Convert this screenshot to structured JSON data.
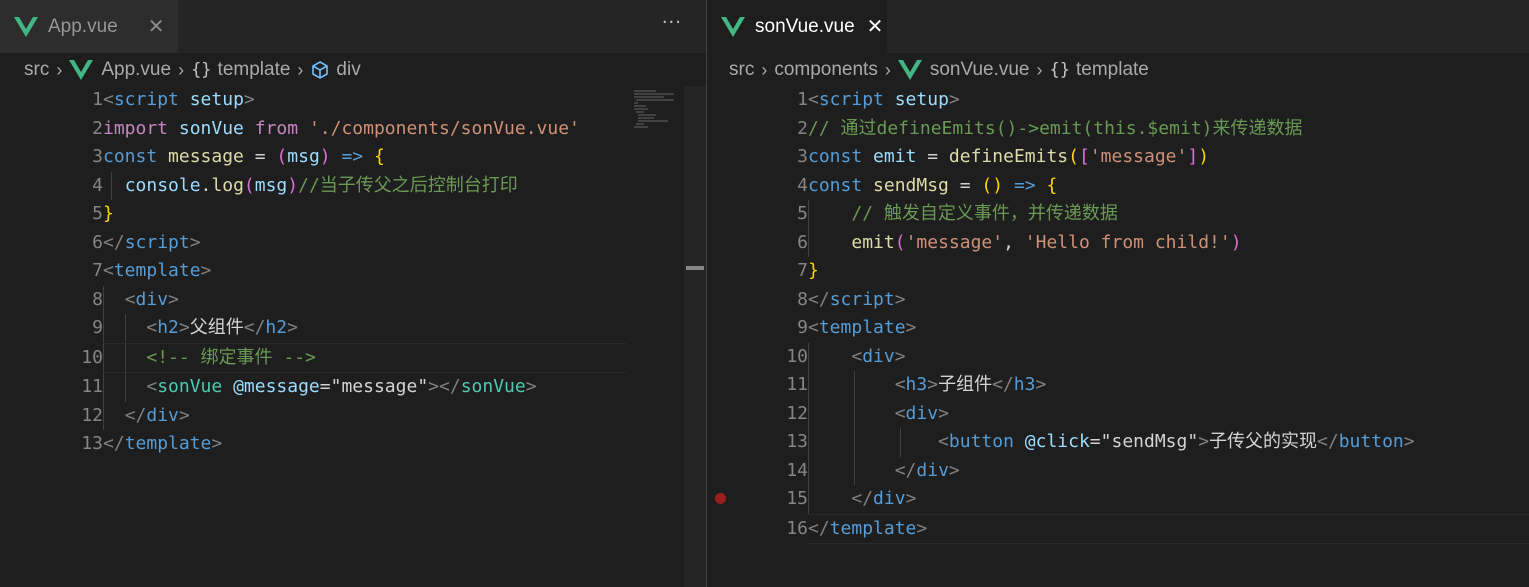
{
  "left": {
    "tab": {
      "label": "App.vue",
      "close": "✕"
    },
    "more": "···",
    "breadcrumb": [
      "src",
      "App.vue",
      "template",
      "div"
    ],
    "lines": [
      "1",
      "2",
      "3",
      "4",
      "5",
      "6",
      "7",
      "8",
      "9",
      "10",
      "11",
      "12",
      "13"
    ]
  },
  "right": {
    "tab": {
      "label": "sonVue.vue",
      "close": "✕"
    },
    "breadcrumb": [
      "src",
      "components",
      "sonVue.vue",
      "template"
    ],
    "lines": [
      "1",
      "2",
      "3",
      "4",
      "5",
      "6",
      "7",
      "8",
      "9",
      "10",
      "11",
      "12",
      "13",
      "14",
      "15",
      "16"
    ]
  },
  "code_left": {
    "l1": {
      "open": "<",
      "name": "script",
      "attr": "setup",
      "close": ">"
    },
    "l2": {
      "import": "import",
      "ident": "sonVue",
      "from": "from",
      "path": "'./components/sonVue.vue'"
    },
    "l3": {
      "const": "const",
      "name": "message",
      "eq": "=",
      "lp": "(",
      "arg": "msg",
      "rp": ")",
      "arrow": "=>",
      "lb": "{"
    },
    "l4": {
      "obj": "console",
      "dot": ".",
      "fn": "log",
      "lp": "(",
      "arg": "msg",
      "rp": ")",
      "comment": "//当子传父之后控制台打印"
    },
    "l5": {
      "rb": "}"
    },
    "l6": {
      "open": "</",
      "name": "script",
      "close": ">"
    },
    "l7": {
      "open": "<",
      "name": "template",
      "close": ">"
    },
    "l8": {
      "open": "<",
      "name": "div",
      "close": ">"
    },
    "l9": {
      "open": "<",
      "name": "h2",
      "close": ">",
      "text": "父组件",
      "open2": "</",
      "name2": "h2",
      "close2": ">"
    },
    "l10": {
      "comment": "<!-- 绑定事件 -->"
    },
    "l11": {
      "open": "<",
      "name": "sonVue",
      "attr": "@message",
      "eq": "=",
      "val": "\"message\"",
      "close": ">",
      "open2": "</",
      "name2": "sonVue",
      "close2": ">"
    },
    "l12": {
      "open": "</",
      "name": "div",
      "close": ">"
    },
    "l13": {
      "open": "</",
      "name": "template",
      "close": ">"
    }
  },
  "code_right": {
    "l1": {
      "open": "<",
      "name": "script",
      "attr": "setup",
      "close": ">"
    },
    "l2": {
      "comment": "// 通过defineEmits()->emit(this.$emit)来传递数据"
    },
    "l3": {
      "const": "const",
      "name": "emit",
      "eq": "=",
      "fn": "defineEmits",
      "lp": "(",
      "lb": "[",
      "str": "'message'",
      "rb": "]",
      "rp": ")"
    },
    "l4": {
      "const": "const",
      "name": "sendMsg",
      "eq": "=",
      "parens": "()",
      "arrow": "=>",
      "lb": "{"
    },
    "l5": {
      "comment": "// 触发自定义事件，并传递数据"
    },
    "l6": {
      "fn": "emit",
      "lp": "(",
      "s1": "'message'",
      "comma": ",",
      "s2": "'Hello from child!'",
      "rp": ")"
    },
    "l7": {
      "rb": "}"
    },
    "l8": {
      "open": "</",
      "name": "script",
      "close": ">"
    },
    "l9": {
      "open": "<",
      "name": "template",
      "close": ">"
    },
    "l10": {
      "open": "<",
      "name": "div",
      "close": ">"
    },
    "l11": {
      "open": "<",
      "name": "h3",
      "close": ">",
      "text": "子组件",
      "open2": "</",
      "name2": "h3",
      "close2": ">"
    },
    "l12": {
      "open": "<",
      "name": "div",
      "close": ">"
    },
    "l13": {
      "open": "<",
      "name": "button",
      "attr": "@click",
      "eq": "=",
      "val": "\"sendMsg\"",
      "close": ">",
      "text": "子传父的实现",
      "open2": "</",
      "name2": "button",
      "close2": ">"
    },
    "l14": {
      "open": "</",
      "name": "div",
      "close": ">"
    },
    "l15": {
      "open": "</",
      "name": "div",
      "close": ">"
    },
    "l16": {
      "open": "</",
      "name": "template",
      "close": ">"
    }
  },
  "colors": {
    "vue_green": "#41b883",
    "breakpoint": "#9a1e1e"
  },
  "icons": [
    "vue-icon",
    "close-icon",
    "more-actions-icon",
    "chevron-right-icon",
    "braces-icon",
    "cube-icon",
    "breakpoint-icon"
  ]
}
